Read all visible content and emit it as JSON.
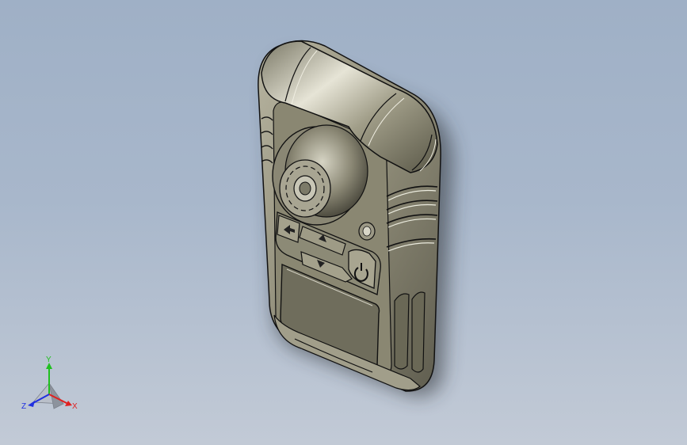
{
  "viewport": {
    "background_top": "#9fb0c6",
    "background_bottom": "#c2cad6"
  },
  "model": {
    "body_color": "#8f8c78",
    "edge_color": "#111111",
    "screen_color": "#6f6d5c"
  },
  "triad": {
    "x_label": "X",
    "y_label": "Y",
    "z_label": "Z",
    "x_color": "#e02020",
    "y_color": "#20c020",
    "z_color": "#2030e0"
  }
}
